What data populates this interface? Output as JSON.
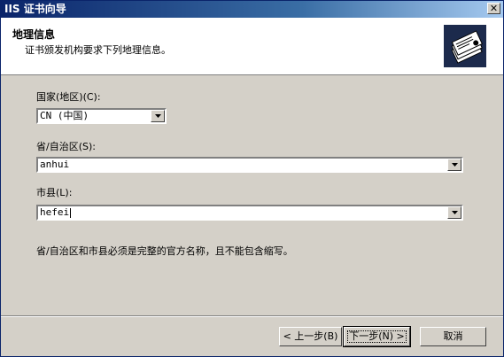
{
  "window": {
    "title": "IIS 证书向导"
  },
  "header": {
    "title": "地理信息",
    "subtitle": "证书颁发机构要求下列地理信息。",
    "icon": "certificate-wizard-icon"
  },
  "form": {
    "country": {
      "label": "国家(地区)(C):",
      "value": "CN (中国)"
    },
    "province": {
      "label": "省/自治区(S):",
      "value": "anhui"
    },
    "city": {
      "label": "市县(L):",
      "value": "hefei"
    },
    "note": "省/自治区和市县必须是完整的官方名称，且不能包含缩写。"
  },
  "buttons": {
    "back": "< 上一步(B)",
    "next": "下一步(N) >",
    "cancel": "取消"
  },
  "colors": {
    "titlebar": "#0a246a",
    "dialog": "#d4d0c8"
  }
}
